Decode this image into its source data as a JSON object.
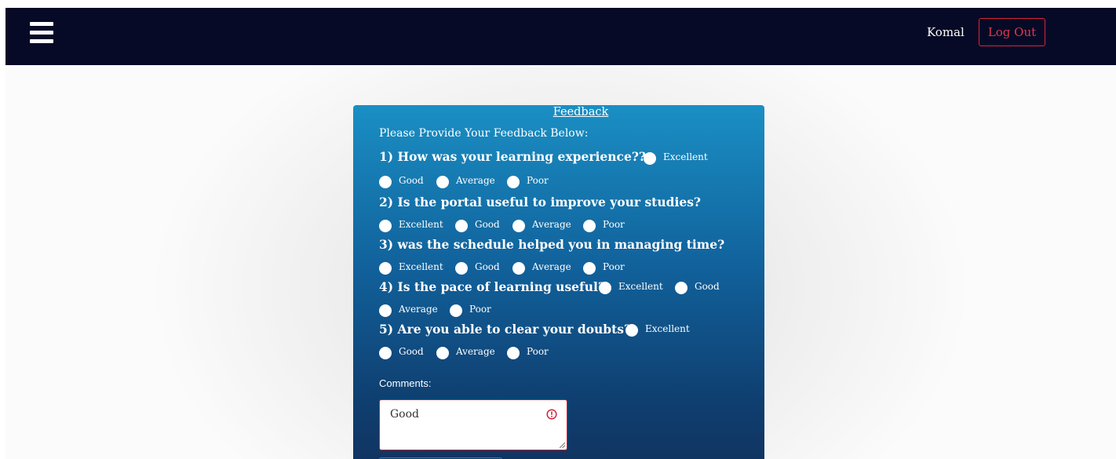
{
  "header": {
    "menu_icon": "hamburger-menu-icon",
    "username": "Komal",
    "logout_label": "Log Out"
  },
  "feedback": {
    "title": "Feedback",
    "intro": "Please Provide Your Feedback Below:",
    "options": [
      "Excellent",
      "Good",
      "Average",
      "Poor"
    ],
    "questions": [
      {
        "text": "1) How was your learning experience??"
      },
      {
        "text": "2) Is the portal useful to improve your studies?"
      },
      {
        "text": "3) was the schedule helped you in managing time?"
      },
      {
        "text": "4) Is the pace of learning useful?"
      },
      {
        "text": "5) Are you able to clear your doubts?"
      }
    ],
    "comments_label": "Comments:",
    "comments_value": "Good",
    "comments_warning_icon": "alert-circle-icon"
  },
  "colors": {
    "navbar": "#060a26",
    "card_top": "#1a8fc4",
    "card_bottom": "#10325f",
    "logout_accent": "#d6263a"
  }
}
